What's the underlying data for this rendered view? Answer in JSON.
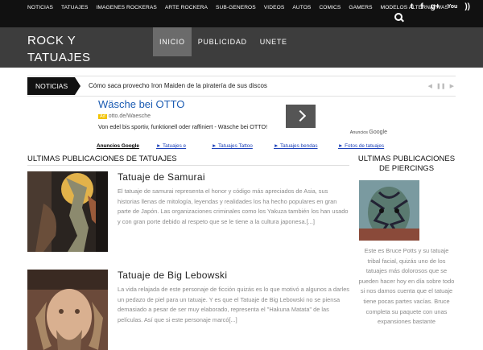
{
  "topnav": {
    "items": [
      "NOTICIAS",
      "TATUAJES",
      "IMAGENES ROCKERAS",
      "ARTE ROCKERA",
      "SUB-GENEROS",
      "VIDEOS",
      "AUTOS",
      "COMICS",
      "GAMERS",
      "MODELOS ALTERNATIVAS"
    ]
  },
  "social": {
    "icons": [
      "twitter-icon",
      "facebook-icon",
      "google-plus-icon",
      "youtube-icon",
      "rss-icon"
    ],
    "twitter": "t",
    "facebook": "f",
    "googleplus": "g+",
    "youtube": "You",
    "rss": "))"
  },
  "logo": {
    "line1": "ROCK Y",
    "line2": "TATUAJES"
  },
  "mainnav": {
    "items": [
      "INICIO",
      "PUBLICIDAD",
      "UNETE"
    ],
    "active": "INICIO"
  },
  "ticker": {
    "label": "NOTICIAS",
    "text": "Cómo saca provecho Iron Maiden de la piratería de sus discos"
  },
  "ad": {
    "title": "Wäsche bei OTTO",
    "badge": "Ad",
    "url": "otto.de/Waesche",
    "desc": "Von edel bis sportiv, funktionell oder raffiniert - Wäsche bei OTTO!",
    "google_small": "Anuncios",
    "google_brand": "Google",
    "links": [
      "Anuncios Google",
      "► Tatuajes e",
      "► Tatuajes Tattoo",
      "► Tatuajes bendas",
      "► Fotos de tatuajes"
    ]
  },
  "main": {
    "title": "ULTIMAS PUBLICACIONES DE TATUAJES",
    "posts": [
      {
        "title": "Tatuaje de Samurai",
        "excerpt": "El tatuaje de samurai representa el honor y código más apreciados de Asia, sus historias llenas de mitología, leyendas y realidades los ha hecho populares en gran parte de Japón. Las organizaciones criminales como los Yakuza también los han usado y con gran porte debido al respeto que se le tiene a la cultura japonesa.[...]"
      },
      {
        "title": "Tatuaje de Big Lebowski",
        "excerpt": "La vida relajada de este personaje de ficción quizás es lo que motivó a algunos a darles un pedazo de piel para un tatuaje. Y es que el Tatuaje de Big Lebowski no se piensa demasiado a pesar de ser muy elaborado, representa el \"Hakuna Matata\" de las películas. Así que si este personaje marcó[...]"
      }
    ]
  },
  "sidebar": {
    "title": "ULTIMAS PUBLICACIONES DE PIERCINGS",
    "text": "Este es Bruce Potts y su tatuaje tribal facial, quizás uno de los tatuajes más dolorosos que se pueden hacer hoy en día sobre todo si nos damos cuenta que el tatuaje tiene pocas partes vacías. Bruce completa su paquete con unas expansiones bastante"
  }
}
